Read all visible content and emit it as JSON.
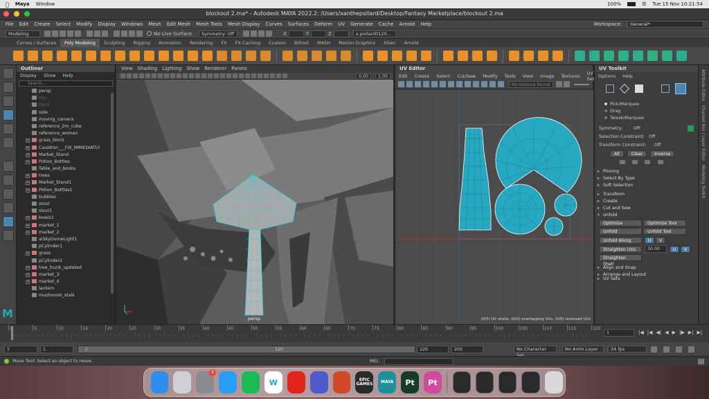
{
  "macos": {
    "app_name": "Maya",
    "window_menu": "Window",
    "battery": "100%",
    "datetime": "Tue 15 Nov  10:21:54"
  },
  "window": {
    "title": "blockout 2.ma* - Autodesk MAYA 2022.2: /Users/xanthepollard/Desktop/Fantasy Marketplace/blockout 2.ma"
  },
  "menubar": [
    "File",
    "Edit",
    "Create",
    "Select",
    "Modify",
    "Display",
    "Windows",
    "Mesh",
    "Edit Mesh",
    "Mesh Tools",
    "Mesh Display",
    "Curves",
    "Surfaces",
    "Deform",
    "UV",
    "Generate",
    "Cache",
    "Arnold",
    "Help"
  ],
  "workspace": {
    "label": "Workspace:",
    "value": "General*"
  },
  "statusline": {
    "menuset": "Modeling",
    "live_surface": "No Live Surface",
    "symmetry": "Symmetry: Off",
    "x_label": "X",
    "y_label": "Y",
    "z_label": "Z",
    "user": "x.pollard0120..."
  },
  "shelf_tabs": [
    "Curves / Surfaces",
    "Poly Modeling",
    "Sculpting",
    "Rigging",
    "Animation",
    "Rendering",
    "FX",
    "FX Caching",
    "Custom",
    "Bifrost",
    "MASH",
    "Motion Graphics",
    "XGen",
    "Arnold"
  ],
  "shelf_active": "Poly Modeling",
  "outliner": {
    "title": "Outliner",
    "menu": [
      "Display",
      "Show",
      "Help"
    ],
    "search_placeholder": "Search...",
    "items": [
      {
        "name": "persp",
        "type": "camera",
        "dim": false,
        "expandable": false
      },
      {
        "name": "top",
        "type": "camera",
        "dim": true,
        "expandable": false
      },
      {
        "name": "front",
        "type": "camera",
        "dim": true,
        "expandable": false
      },
      {
        "name": "side",
        "type": "camera",
        "dim": false,
        "expandable": false
      },
      {
        "name": "movnig_camera",
        "type": "camera",
        "dim": false,
        "expandable": false
      },
      {
        "name": "reference_2m_cube",
        "type": "camera",
        "dim": false,
        "expandable": false
      },
      {
        "name": "reference_woman",
        "type": "camera",
        "dim": false,
        "expandable": false
      },
      {
        "name": "grass_block",
        "type": "group",
        "dim": false,
        "expandable": true
      },
      {
        "name": "Cauldron___FIX_IMMEDIATLY",
        "type": "group",
        "dim": false,
        "expandable": true
      },
      {
        "name": "Market_Stand",
        "type": "group",
        "dim": false,
        "expandable": true
      },
      {
        "name": "Potion_Bottles",
        "type": "group",
        "dim": false,
        "expandable": true
      },
      {
        "name": "Table_and_books",
        "type": "mesh",
        "dim": false,
        "expandable": false
      },
      {
        "name": "trees",
        "type": "group",
        "dim": false,
        "expandable": true
      },
      {
        "name": "Market_Stand1",
        "type": "group",
        "dim": false,
        "expandable": true
      },
      {
        "name": "Potion_Bottles1",
        "type": "group",
        "dim": false,
        "expandable": true
      },
      {
        "name": "bubbles",
        "type": "mesh",
        "dim": false,
        "expandable": false
      },
      {
        "name": "stool",
        "type": "mesh",
        "dim": false,
        "expandable": false
      },
      {
        "name": "stool1",
        "type": "mesh",
        "dim": false,
        "expandable": false
      },
      {
        "name": "bowls1",
        "type": "group",
        "dim": false,
        "expandable": true
      },
      {
        "name": "market_1",
        "type": "group",
        "dim": false,
        "expandable": true
      },
      {
        "name": "market_2",
        "type": "group",
        "dim": false,
        "expandable": true
      },
      {
        "name": "aiSkyDomeLight1",
        "type": "light",
        "dim": false,
        "expandable": false
      },
      {
        "name": "pCylinder1",
        "type": "mesh",
        "dim": false,
        "expandable": false
      },
      {
        "name": "grass",
        "type": "group",
        "dim": false,
        "expandable": true
      },
      {
        "name": "pCylinder2",
        "type": "mesh",
        "dim": false,
        "expandable": false
      },
      {
        "name": "tree_trunk_updated",
        "type": "group",
        "dim": false,
        "expandable": true
      },
      {
        "name": "market_3",
        "type": "group",
        "dim": false,
        "expandable": true
      },
      {
        "name": "market_4",
        "type": "group",
        "dim": false,
        "expandable": true
      },
      {
        "name": "lantern",
        "type": "mesh",
        "dim": false,
        "expandable": false
      },
      {
        "name": "mushroom_stalk",
        "type": "mesh",
        "dim": false,
        "expandable": false
      }
    ]
  },
  "viewport": {
    "menu": [
      "View",
      "Shading",
      "Lighting",
      "Show",
      "Renderer",
      "Panels"
    ],
    "field_a": "0.00",
    "field_b": "1.00",
    "camera_label": "persp"
  },
  "uv_editor": {
    "title": "UV Editor",
    "menu": [
      "Edit",
      "Create",
      "Select",
      "Cut/Sew",
      "Modify",
      "Tools",
      "View",
      "Image",
      "Textures",
      "UV Sets"
    ],
    "texture_status": "No texture found",
    "stats": "(0/5) UV shells, (0/0) overlapping UVs, (0/0) reversed UVs"
  },
  "uv_toolkit": {
    "title": "UV Toolkit",
    "menu": [
      "Options",
      "Help"
    ],
    "modes": [
      "Pick/Marquee",
      "Drag",
      "Tweak/Marquee"
    ],
    "symmetry": {
      "label": "Symmetry:",
      "value": "Off"
    },
    "selection_constraint": {
      "label": "Selection Constraint:",
      "value": "Off"
    },
    "transform_constraint": {
      "label": "Transform Constraint:",
      "value": "Off"
    },
    "buttons": [
      "All",
      "Clear",
      "Inverse"
    ],
    "sections_top": [
      "Pinning",
      "Select By Type",
      "Soft Selection"
    ],
    "sections_mid": [
      "Transform",
      "Create",
      "Cut and Sew",
      "Unfold"
    ],
    "unfold": {
      "optimize": "Optimize",
      "optimize_tool": "Optimize Tool",
      "unfold": "Unfold",
      "unfold_tool": "Unfold Tool",
      "unfold_along": "Unfold Along",
      "u": "U",
      "v": "V",
      "straighten_uvs": "Straighten UVs",
      "straighten_value": "30.00",
      "straighten_shell": "Straighten Shell"
    },
    "sections_bottom": [
      "Align and Snap",
      "Arrange and Layout"
    ],
    "uv_sets": "UV Sets"
  },
  "right_strip": [
    "Attribute Editor",
    "Channel Box / Layer Editor",
    "Modeling Toolkit"
  ],
  "timeline": {
    "ticks": [
      "1",
      "5",
      "10",
      "15",
      "20",
      "25",
      "30",
      "35",
      "40",
      "45",
      "50",
      "55",
      "60",
      "65",
      "70",
      "75",
      "80",
      "85",
      "90",
      "95",
      "100",
      "105",
      "110",
      "115",
      "120"
    ],
    "current_frame": "1"
  },
  "range": {
    "start": "1",
    "playback_start": "1",
    "slider_start": "1",
    "slider_end": "120",
    "playback_end": "120",
    "end": "200",
    "character_set": "No Character Set",
    "anim_layer": "No Anim Layer",
    "fps": "24 fps"
  },
  "helpline": {
    "message": "Move Tool: Select an object to move.",
    "mel": "MEL"
  },
  "dock": [
    {
      "name": "Finder",
      "color": "#2d8ef0",
      "label": ""
    },
    {
      "name": "Launchpad",
      "color": "#cfcfd6",
      "label": ""
    },
    {
      "name": "System Preferences",
      "color": "#8a8a90",
      "label": ""
    },
    {
      "name": "Safari",
      "color": "#2a9df4",
      "label": ""
    },
    {
      "name": "Spotify",
      "color": "#1db954",
      "label": ""
    },
    {
      "name": "Wrike",
      "color": "#ffffff",
      "label": "W"
    },
    {
      "name": "Acrobat",
      "color": "#e3241b",
      "label": ""
    },
    {
      "name": "Teams",
      "color": "#5059c9",
      "label": ""
    },
    {
      "name": "PowerPoint",
      "color": "#d24726",
      "label": ""
    },
    {
      "name": "Epic Games",
      "color": "#2a2a2a",
      "label": "EPIC GAMES"
    },
    {
      "name": "Maya",
      "color": "#1f8f9a",
      "label": "MAYA"
    },
    {
      "name": "Substance Painter",
      "color": "#1b3b2a",
      "label": "Pt"
    },
    {
      "name": "Substance Painter 2",
      "color": "#d34a9a",
      "label": "Pt"
    }
  ],
  "dock_badge": "1"
}
